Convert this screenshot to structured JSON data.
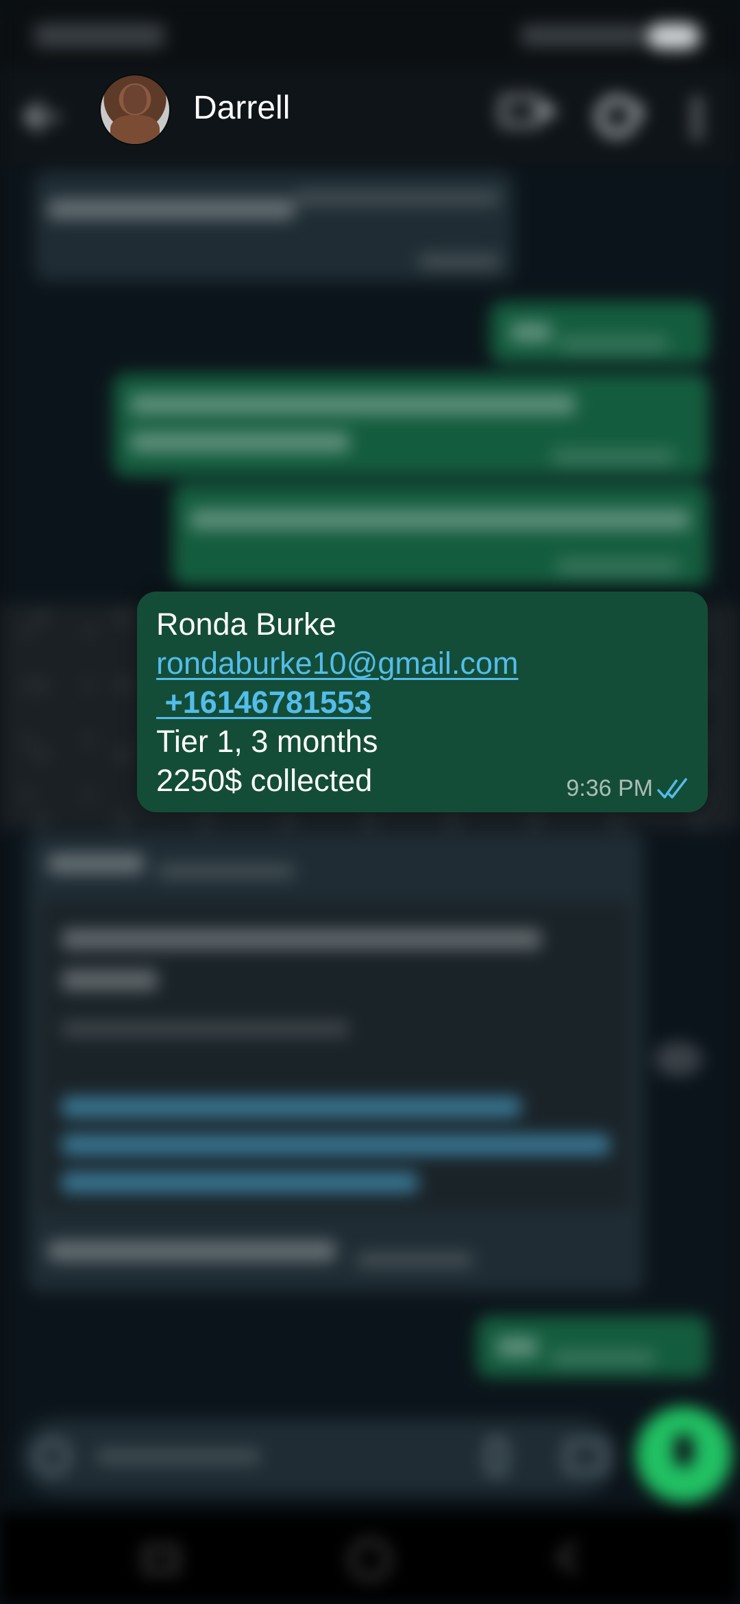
{
  "header": {
    "contact_name": "Darrell"
  },
  "focused_message": {
    "direction": "outgoing",
    "lines": {
      "name": "Ronda Burke",
      "email": "rondaburke10@gmail.com",
      "phone": " +16146781553",
      "tier": "Tier 1, 3 months",
      "amount": "2250$ collected"
    },
    "time": "9:36 PM",
    "status": "read"
  },
  "colors": {
    "accent_green": "#21c063",
    "outgoing_bubble": "#144d37",
    "link": "#53bdeb",
    "read_ticks": "#53bdeb",
    "background": "#0b141a"
  },
  "icons": [
    "back-arrow-icon",
    "video-call-icon",
    "phone-call-icon",
    "more-options-icon",
    "double-check-icon",
    "mic-icon",
    "emoji-icon",
    "attach-icon",
    "camera-icon"
  ]
}
